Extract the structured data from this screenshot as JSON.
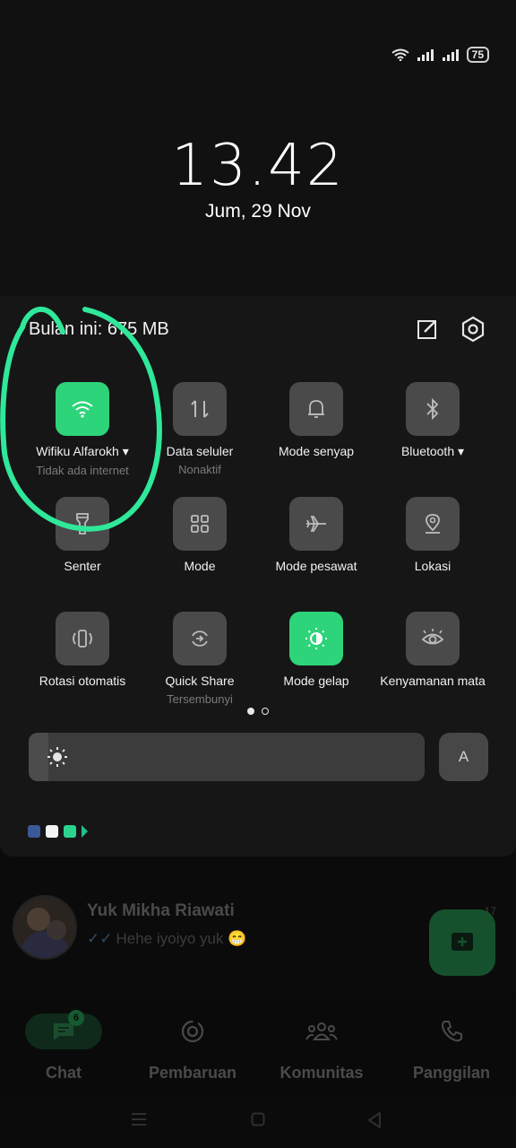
{
  "status_bar": {
    "battery": "75",
    "icons": [
      "wifi-icon",
      "signal-icon",
      "signal-icon-2"
    ]
  },
  "lock": {
    "time": "13.42",
    "date": "Jum, 29 Nov"
  },
  "panel": {
    "usage": "Bulan ini: 675 MB",
    "tiles": [
      {
        "label": "Wifiku Alfarokh ▾",
        "sub": "Tidak ada internet",
        "icon": "wifi-icon",
        "on": true
      },
      {
        "label": "Data seluler",
        "sub": "Nonaktif",
        "icon": "data-arrows-icon",
        "on": false
      },
      {
        "label": "Mode senyap",
        "sub": "",
        "icon": "bell-icon",
        "on": false
      },
      {
        "label": "Bluetooth ▾",
        "sub": "",
        "icon": "bluetooth-icon",
        "on": false
      },
      {
        "label": "Senter",
        "sub": "",
        "icon": "flashlight-icon",
        "on": false
      },
      {
        "label": "Mode",
        "sub": "",
        "icon": "grid-icon",
        "on": false
      },
      {
        "label": "Mode pesawat",
        "sub": "",
        "icon": "airplane-icon",
        "on": false
      },
      {
        "label": "Lokasi",
        "sub": "",
        "icon": "location-icon",
        "on": false
      },
      {
        "label": "Rotasi otomatis",
        "sub": "",
        "icon": "rotate-icon",
        "on": false
      },
      {
        "label": "Quick Share",
        "sub": "Tersembunyi",
        "icon": "share-icon",
        "on": false
      },
      {
        "label": "Mode gelap",
        "sub": "",
        "icon": "dark-mode-icon",
        "on": true
      },
      {
        "label": "Kenyamanan mata",
        "sub": "",
        "icon": "eye-icon",
        "on": false
      }
    ],
    "brightness_level": 0.05,
    "auto_label": "A",
    "accent_color": "#2ed47a"
  },
  "chat": {
    "name": "Yuk Mikha Riawati",
    "message": "Hehe iyoiyo yuk 😁",
    "time": "17"
  },
  "bottom_nav": {
    "chat": "Chat",
    "chat_badge": "6",
    "updates": "Pembaruan",
    "communities": "Komunitas",
    "calls": "Panggilan"
  }
}
